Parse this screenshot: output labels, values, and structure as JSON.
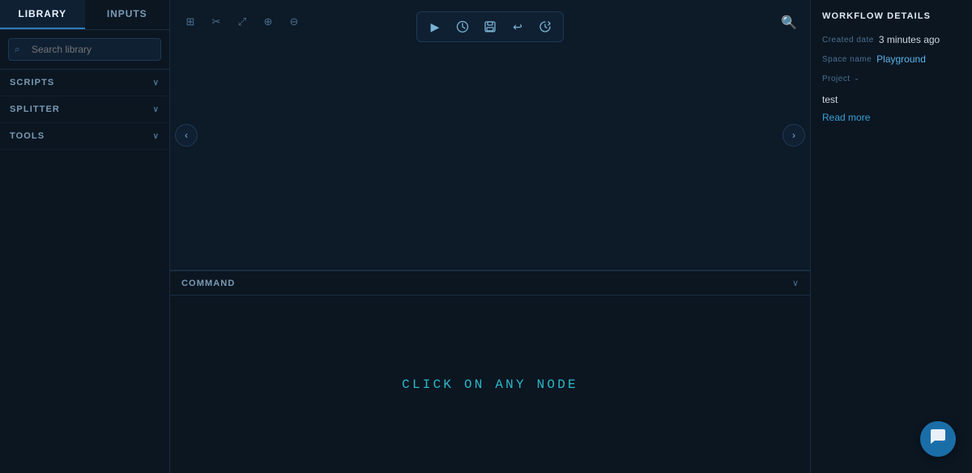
{
  "sidebar": {
    "tab_library": "LIBRARY",
    "tab_inputs": "INPUTS",
    "search_placeholder": "Search library",
    "sections": [
      {
        "id": "scripts",
        "label": "SCRIPTS"
      },
      {
        "id": "splitter",
        "label": "SPLITTER"
      },
      {
        "id": "tools",
        "label": "TOOLS"
      }
    ]
  },
  "toolbar": {
    "play_icon": "▶",
    "clock_icon": "⏱",
    "save_icon": "💾",
    "undo_icon": "↩",
    "history_icon": "⟳"
  },
  "canvas_controls": {
    "grid_icon": "⊞",
    "crop_icon": "✂",
    "expand_icon": "⤢",
    "zoom_in_icon": "🔍",
    "zoom_out_icon": "⊖",
    "search_icon": "🔍"
  },
  "nav": {
    "left_arrow": "‹",
    "right_arrow": "›"
  },
  "command_panel": {
    "title": "COMMAND",
    "click_node_text": "CLICK ON ANY NODE",
    "chevron": "∨"
  },
  "right_panel": {
    "title": "WORKFLOW DETAILS",
    "created_date_label": "Created date",
    "created_date_value": "3 minutes ago",
    "space_name_label": "Space name",
    "space_name_value": "Playground",
    "project_label": "Project",
    "project_dash": "-",
    "description": "test",
    "read_more_label": "Read more"
  },
  "chat": {
    "icon": "💬"
  }
}
